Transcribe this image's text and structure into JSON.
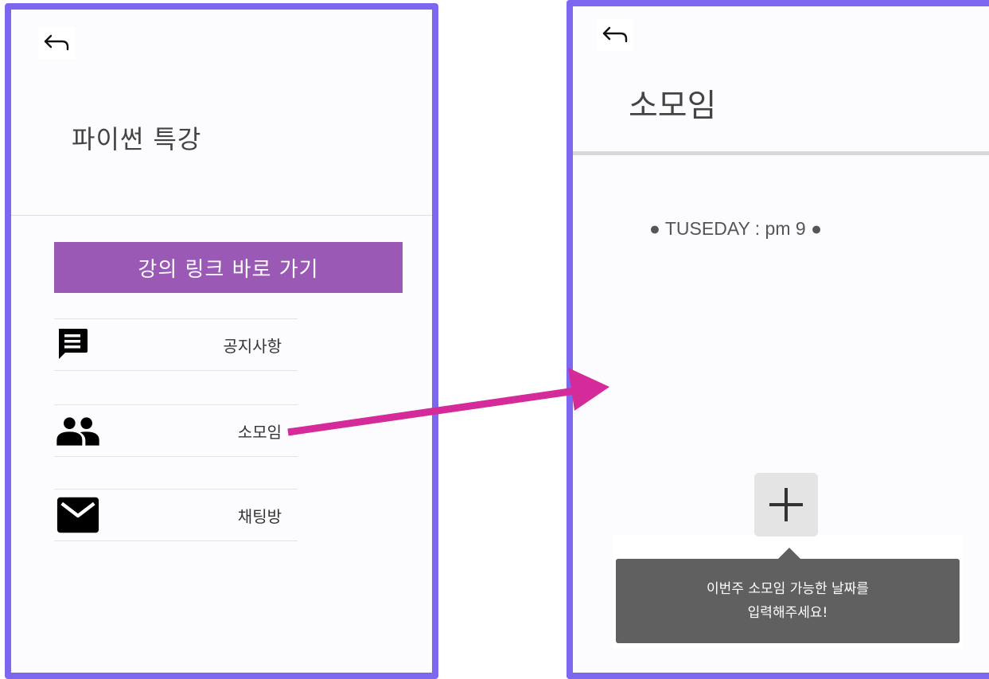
{
  "left_screen": {
    "title": "파이썬 특강",
    "back_icon": "back-arrow-icon",
    "lecture_link_button": "강의 링크 바로 가기",
    "menu_items": [
      {
        "label": "공지사항",
        "icon": "message-icon"
      },
      {
        "label": "소모임",
        "icon": "group-icon"
      },
      {
        "label": "채팅방",
        "icon": "mail-icon"
      }
    ]
  },
  "right_screen": {
    "title": "소모임",
    "back_icon": "back-arrow-icon",
    "schedule": "● TUSEDAY : pm 9 ●",
    "add_icon": "plus-icon",
    "tooltip_line1": "이번주 소모임 가능한 날짜를",
    "tooltip_line2": "입력해주세요!"
  },
  "colors": {
    "frame_border": "#7b68ee",
    "button_purple": "#9b59b6",
    "arrow_magenta": "#d42a9a",
    "tooltip_bg": "#606060"
  }
}
